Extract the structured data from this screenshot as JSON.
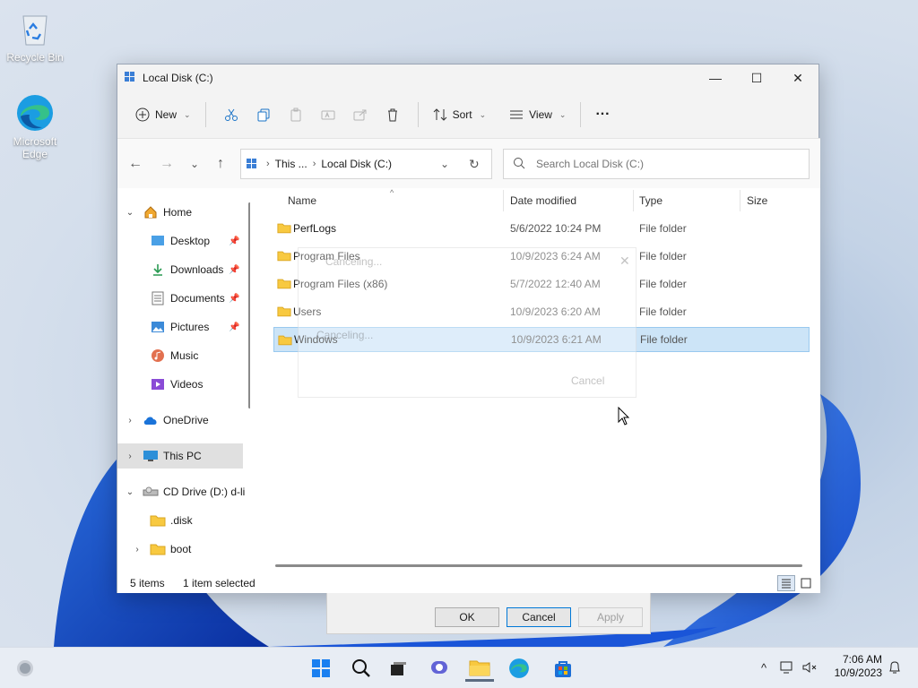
{
  "desktop": {
    "icons": [
      {
        "label": "Recycle Bin",
        "icon": "recycle-bin-icon"
      },
      {
        "label": "Microsoft Edge",
        "icon": "edge-icon"
      }
    ]
  },
  "window": {
    "title": "Local Disk (C:)",
    "controls": {
      "minimize": "—",
      "maximize": "☐",
      "close": "✕"
    }
  },
  "toolbar": {
    "new_label": "New",
    "sort_label": "Sort",
    "view_label": "View",
    "more_label": "···"
  },
  "address": {
    "crumbs": [
      "This ...",
      "Local Disk (C:)"
    ],
    "search_placeholder": "Search Local Disk (C:)"
  },
  "nav": {
    "home": "Home",
    "desktop": "Desktop",
    "downloads": "Downloads",
    "documents": "Documents",
    "pictures": "Pictures",
    "music": "Music",
    "videos": "Videos",
    "onedrive": "OneDrive",
    "thispc": "This PC",
    "cddrive": "CD Drive (D:) d-li",
    "disk": ".disk",
    "boot": "boot"
  },
  "columns": {
    "name": "Name",
    "date": "Date modified",
    "type": "Type",
    "size": "Size"
  },
  "files": [
    {
      "name": "PerfLogs",
      "date": "5/6/2022 10:24 PM",
      "type": "File folder"
    },
    {
      "name": "Program Files",
      "date": "10/9/2023 6:24 AM",
      "type": "File folder"
    },
    {
      "name": "Program Files (x86)",
      "date": "5/7/2022 12:40 AM",
      "type": "File folder"
    },
    {
      "name": "Users",
      "date": "10/9/2023 6:20 AM",
      "type": "File folder"
    },
    {
      "name": "Windows",
      "date": "10/9/2023 6:21 AM",
      "type": "File folder"
    }
  ],
  "status": {
    "count": "5 items",
    "selection": "1 item selected"
  },
  "ghost_dialog": {
    "title": "Canceling...",
    "status": "Canceling...",
    "cancel": "Cancel"
  },
  "property_dialog": {
    "ok": "OK",
    "cancel": "Cancel",
    "apply": "Apply"
  },
  "taskbar": {
    "time": "7:06 AM",
    "date": "10/9/2023"
  }
}
